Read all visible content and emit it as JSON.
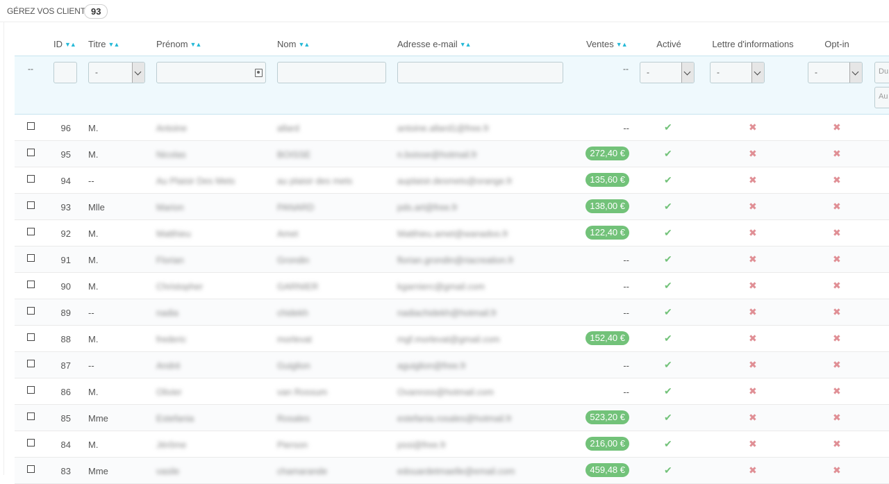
{
  "panel": {
    "title": "Gérez vos clients",
    "count": "93"
  },
  "columns": {
    "id": "ID",
    "title": "Titre",
    "firstname": "Prénom",
    "lastname": "Nom",
    "email": "Adresse e-mail",
    "sales": "Ventes",
    "active": "Activé",
    "newsletter": "Lettre d'informations",
    "optin": "Opt-in"
  },
  "sort_icons": {
    "desc": "▼",
    "asc": "▲"
  },
  "filters": {
    "bulk_placeholder": "--",
    "sales_placeholder": "--",
    "title_select": "-",
    "active_select": "-",
    "newsletter_select": "-",
    "optin_select": "-",
    "date_from_placeholder": "Du",
    "date_to_placeholder": "Au"
  },
  "icons": {
    "active": "check-icon",
    "newsletter": "cross-icon",
    "optin": "cross-icon",
    "check_glyph": "✔",
    "cross_glyph": "✖"
  },
  "colors": {
    "accent": "#25b9d7",
    "success": "#72c279",
    "danger": "#e08f95",
    "filter_bg": "#eff9fd"
  },
  "rows": [
    {
      "id": "96",
      "title": "M.",
      "firstname": "Antoine",
      "lastname": "allard",
      "email": "antoine.allard1@free.fr",
      "sales": "--"
    },
    {
      "id": "95",
      "title": "M.",
      "firstname": "Nicolas",
      "lastname": "BOISSE",
      "email": "n.boisse@hotmail.fr",
      "sales": "272,40 €"
    },
    {
      "id": "94",
      "title": "--",
      "firstname": "Au Plaisir Des Mets",
      "lastname": "au plaisir des mets",
      "email": "auplaisir.desmets@orange.fr",
      "sales": "135,60 €"
    },
    {
      "id": "93",
      "title": "Mlle",
      "firstname": "Marion",
      "lastname": "PANARD",
      "email": "pds.art@free.fr",
      "sales": "138,00 €"
    },
    {
      "id": "92",
      "title": "M.",
      "firstname": "Matthieu",
      "lastname": "Amet",
      "email": "Matthieu.amet@wanadoo.fr",
      "sales": "122,40 €"
    },
    {
      "id": "91",
      "title": "M.",
      "firstname": "Florian",
      "lastname": "Grondin",
      "email": "florian.grondin@riacreation.fr",
      "sales": "--"
    },
    {
      "id": "90",
      "title": "M.",
      "firstname": "Christopher",
      "lastname": "GARNIER",
      "email": "kgarnierc@gmail.com",
      "sales": "--"
    },
    {
      "id": "89",
      "title": "--",
      "firstname": "nadia",
      "lastname": "chidekh",
      "email": "nadiachidekh@hotmail.fr",
      "sales": "--"
    },
    {
      "id": "88",
      "title": "M.",
      "firstname": "frederic",
      "lastname": "morlevat",
      "email": "mgf.morlevat@gmail.com",
      "sales": "152,40 €"
    },
    {
      "id": "87",
      "title": "--",
      "firstname": "André",
      "lastname": "Guiglion",
      "email": "aguiglion@free.fr",
      "sales": "--"
    },
    {
      "id": "86",
      "title": "M.",
      "firstname": "Olivier",
      "lastname": "van Rossum",
      "email": "Ovanross@hotmail.com",
      "sales": "--"
    },
    {
      "id": "85",
      "title": "Mme",
      "firstname": "Estefania",
      "lastname": "Rosales",
      "email": "estefania.rosales@hotmail.fr",
      "sales": "523,20 €"
    },
    {
      "id": "84",
      "title": "M.",
      "firstname": "Jérôme",
      "lastname": "Pierson",
      "email": "pssi@free.fr",
      "sales": "216,00 €"
    },
    {
      "id": "83",
      "title": "Mme",
      "firstname": "vasile",
      "lastname": "chamarande",
      "email": "edouardetmaelle@email.com",
      "sales": "459,48 €"
    }
  ]
}
